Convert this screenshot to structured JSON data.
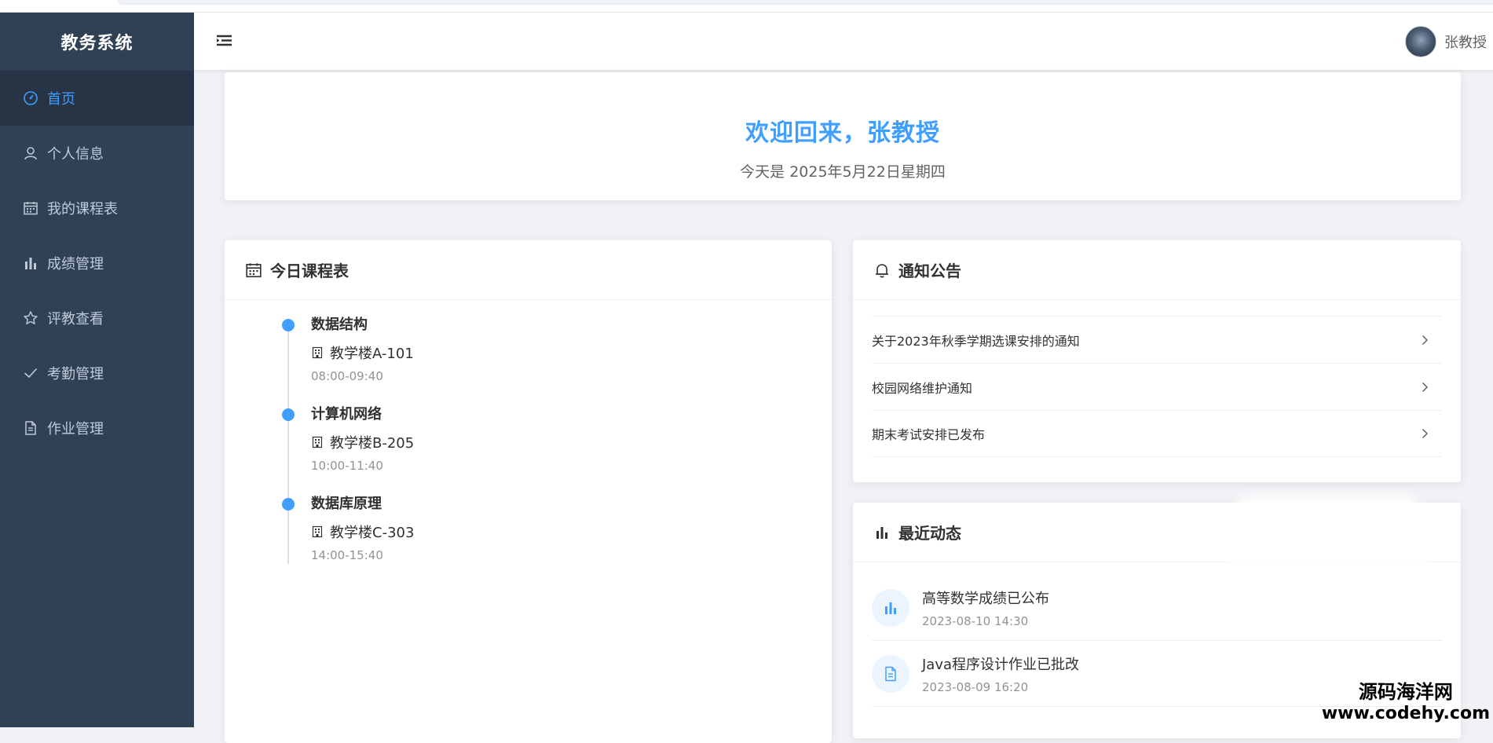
{
  "app": {
    "brand": "教务系统"
  },
  "sidebar": {
    "items": [
      {
        "label": "首页",
        "icon": "dashboard-icon",
        "active": true
      },
      {
        "label": "个人信息",
        "icon": "user-icon"
      },
      {
        "label": "我的课程表",
        "icon": "calendar-icon"
      },
      {
        "label": "成绩管理",
        "icon": "bar-chart-icon"
      },
      {
        "label": "评教查看",
        "icon": "star-icon"
      },
      {
        "label": "考勤管理",
        "icon": "check-icon"
      },
      {
        "label": "作业管理",
        "icon": "document-icon"
      }
    ]
  },
  "header": {
    "username": "张教授"
  },
  "welcome": {
    "title": "欢迎回来，张教授",
    "date": "今天是 2025年5月22日星期四"
  },
  "schedule": {
    "title": "今日课程表",
    "items": [
      {
        "name": "数据结构",
        "location": "教学楼A-101",
        "time": "08:00-09:40"
      },
      {
        "name": "计算机网络",
        "location": "教学楼B-205",
        "time": "10:00-11:40"
      },
      {
        "name": "数据库原理",
        "location": "教学楼C-303",
        "time": "14:00-15:40"
      }
    ]
  },
  "notices": {
    "title": "通知公告",
    "items": [
      "关于2023年秋季学期选课安排的通知",
      "校园网络维护通知",
      "期末考试安排已发布"
    ]
  },
  "activity": {
    "title": "最近动态",
    "items": [
      {
        "title": "高等数学成绩已公布",
        "time": "2023-08-10 14:30",
        "icon": "bar-chart-icon"
      },
      {
        "title": "Java程序设计作业已批改",
        "time": "2023-08-09 16:20",
        "icon": "document-icon"
      }
    ]
  },
  "watermark": {
    "line1": "源码海洋网",
    "line2": "www.codehy.com"
  },
  "colors": {
    "primary": "#409eff",
    "sidebar_bg": "#304156",
    "sidebar_active_bg": "#263445",
    "sidebar_text": "#bfcbd9"
  }
}
